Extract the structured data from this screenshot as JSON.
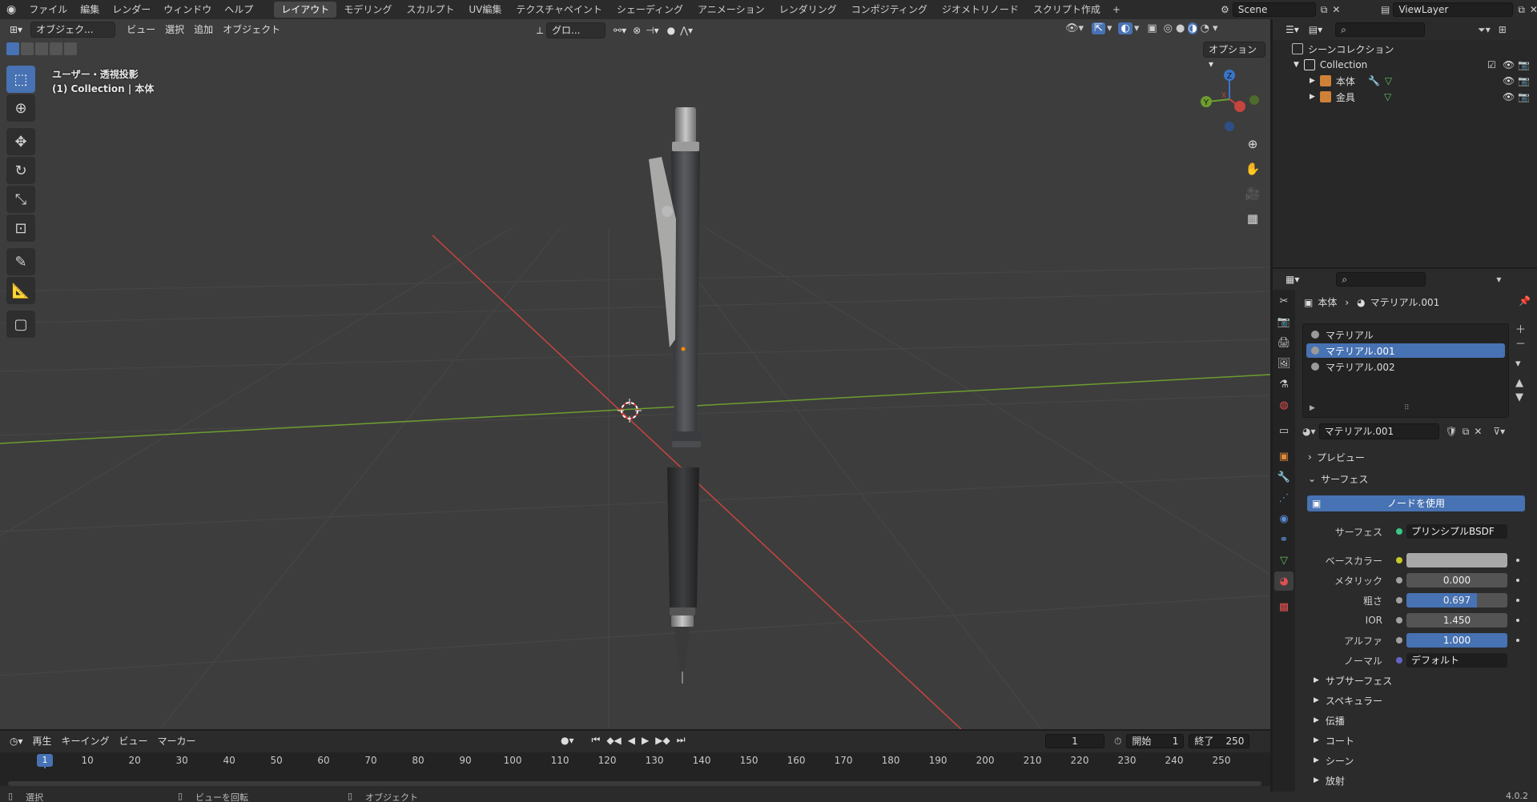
{
  "menu": {
    "items": [
      "ファイル",
      "編集",
      "レンダー",
      "ウィンドウ",
      "ヘルプ"
    ]
  },
  "workspaces": {
    "tabs": [
      "レイアウト",
      "モデリング",
      "スカルプト",
      "UV編集",
      "テクスチャペイント",
      "シェーディング",
      "アニメーション",
      "レンダリング",
      "コンポジティング",
      "ジオメトリノード",
      "スクリプト作成"
    ],
    "active": "レイアウト"
  },
  "scene": {
    "name": "Scene",
    "view_layer": "ViewLayer"
  },
  "viewport": {
    "mode": "オブジェク...",
    "menus": [
      "ビュー",
      "選択",
      "追加",
      "オブジェクト"
    ],
    "transform_orientation": "グロ...",
    "options_label": "オプション",
    "info_line1": "ユーザー・透視投影",
    "info_line2": "(1) Collection | 本体",
    "gizmo_labels": {
      "z": "Z",
      "y": "Y",
      "x": "X"
    }
  },
  "timeline": {
    "menus": [
      "再生",
      "キーイング",
      "ビュー",
      "マーカー"
    ],
    "current_frame": "1",
    "start_label": "開始",
    "start_value": "1",
    "end_label": "終了",
    "end_value": "250",
    "ticks": [
      "1",
      "10",
      "20",
      "30",
      "40",
      "50",
      "60",
      "70",
      "80",
      "90",
      "100",
      "110",
      "120",
      "130",
      "140",
      "150",
      "160",
      "170",
      "180",
      "190",
      "200",
      "210",
      "220",
      "230",
      "240",
      "250"
    ]
  },
  "statusbar": {
    "left": "選択",
    "middle": "ビューを回転",
    "right": "オブジェクト",
    "version": "4.0.2"
  },
  "outliner": {
    "scene_collection": "シーンコレクション",
    "collection": "Collection",
    "objects": [
      "本体",
      "金具"
    ]
  },
  "properties": {
    "breadcrumb_object": "本体",
    "breadcrumb_material": "マテリアル.001",
    "slots": [
      "マテリアル",
      "マテリアル.001",
      "マテリアル.002"
    ],
    "selected_slot": "マテリアル.001",
    "material_name": "マテリアル.001",
    "preview_label": "プレビュー",
    "surface_panel": "サーフェス",
    "use_nodes": "ノードを使用",
    "surface_label": "サーフェス",
    "surface_value": "プリンシプルBSDF",
    "fields": [
      {
        "label": "ベースカラー",
        "value": ""
      },
      {
        "label": "メタリック",
        "value": "0.000"
      },
      {
        "label": "粗さ",
        "value": "0.697"
      },
      {
        "label": "IOR",
        "value": "1.450"
      },
      {
        "label": "アルファ",
        "value": "1.000"
      },
      {
        "label": "ノーマル",
        "value": "デフォルト"
      }
    ],
    "subpanels": [
      "サブサーフェス",
      "スペキュラー",
      "伝播",
      "コート",
      "シーン",
      "放射"
    ]
  },
  "colors": {
    "accent": "#4772b3",
    "x_axis": "#c6453f",
    "y_axis": "#6c9e2e",
    "z_axis": "#3a74c9"
  }
}
